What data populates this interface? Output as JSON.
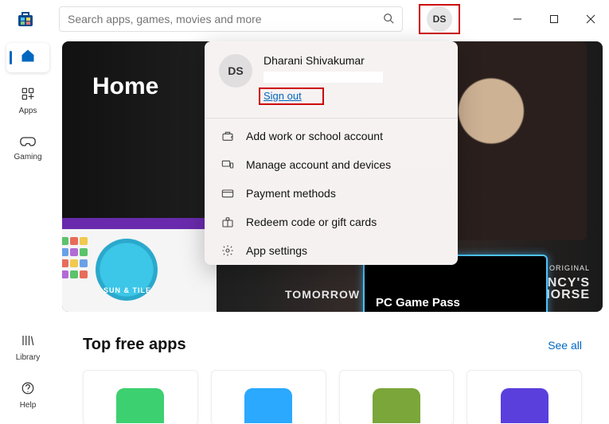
{
  "titlebar": {
    "search_placeholder": "Search apps, games, movies and more",
    "avatar_initials": "DS"
  },
  "nav": {
    "home_label": "",
    "apps_label": "Apps",
    "gaming_label": "Gaming",
    "library_label": "Library",
    "help_label": "Help"
  },
  "hero": {
    "title": "Home",
    "pc_game_pass": "PC Game Pass",
    "amazon_tag": "AMAZON ORIGINAL",
    "tom_line1": "TOM CLANCY'S",
    "tom_line2": "WITHOUT REMORSE",
    "tomorrow": "TOMORROW WAR",
    "spline_badge": "SUN & TILE"
  },
  "section": {
    "title": "Top free apps",
    "see_all": "See all"
  },
  "popover": {
    "avatar_initials": "DS",
    "user_name": "Dharani Shivakumar",
    "sign_out": "Sign out",
    "items": {
      "add_work": "Add work or school account",
      "manage": "Manage account and devices",
      "payment": "Payment methods",
      "redeem": "Redeem code or gift cards",
      "settings": "App settings"
    }
  }
}
